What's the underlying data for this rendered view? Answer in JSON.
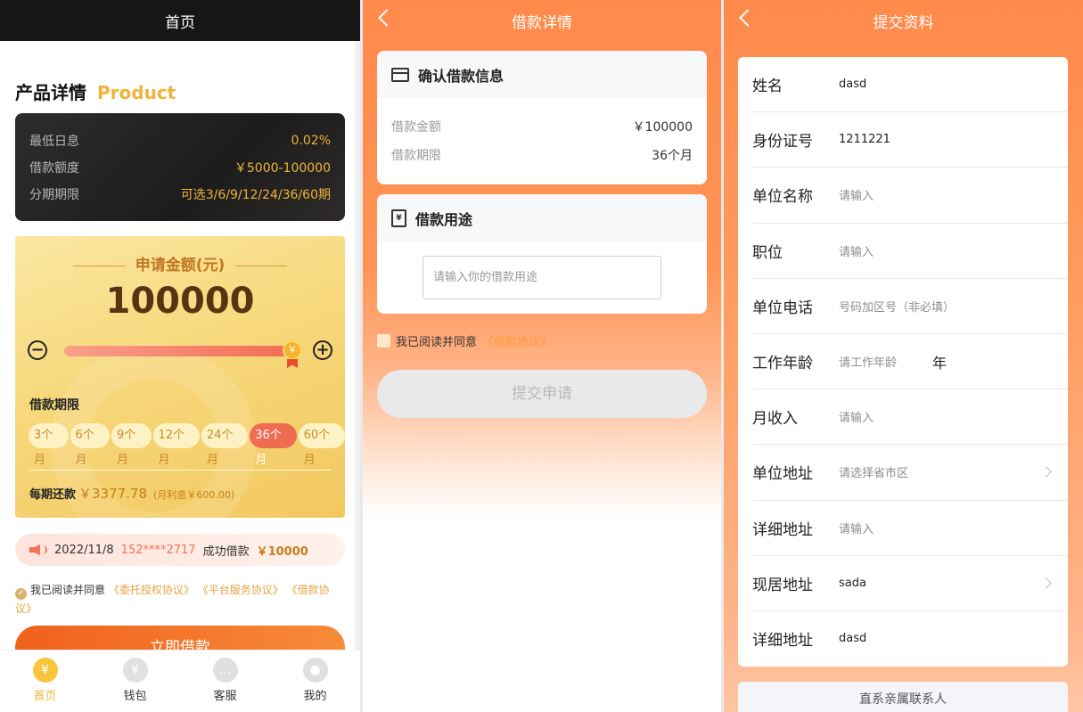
{
  "panel1": {
    "header_title": "首页",
    "heading_zh": "产品详情",
    "heading_en": "Product",
    "rates": [
      {
        "label": "最低日息",
        "value": "0.02%"
      },
      {
        "label": "借款额度",
        "value": "￥5000-100000"
      },
      {
        "label": "分期期限",
        "value": "可选3/6/9/12/24/36/60期"
      }
    ],
    "apply_title": "申请金额(元)",
    "amount": "100000",
    "minus": "−",
    "plus": "+",
    "knob": "¥",
    "slider_level_percent": 100,
    "term_label": "借款期限",
    "terms": [
      "3个月",
      "6个月",
      "9个月",
      "12个月",
      "24个月",
      "36个月",
      "60个月"
    ],
    "active_term_index": 5,
    "repay_label": "每期还款",
    "repay_value": "￥3377.78",
    "repay_interest": "(月利息￥600.00)",
    "notice": {
      "date": "2022/11/8",
      "phone": "152****2717",
      "text": "成功借款",
      "amount": "￥10000"
    },
    "agree_prefix": "我已阅读并同意",
    "agree_links": [
      "《委托授权协议》",
      "《平台服务协议》",
      "《借款协议》"
    ],
    "check_mark": "✓",
    "primary_button": "立即借款",
    "tabs": [
      {
        "label": "首页",
        "icon": "¥",
        "active": true
      },
      {
        "label": "钱包",
        "icon": "¥",
        "active": false
      },
      {
        "label": "客服",
        "icon": "…",
        "active": false
      },
      {
        "label": "我的",
        "icon": "●",
        "active": false
      }
    ]
  },
  "panel2": {
    "header_title": "借款详情",
    "confirm_title": "确认借款信息",
    "loan_amount_label": "借款金额",
    "loan_amount_value": "￥100000",
    "loan_term_label": "借款期限",
    "loan_term_value": "36个月",
    "purpose_title": "借款用途",
    "purpose_icon_glyph": "¥",
    "purpose_placeholder": "请输入你的借款用途",
    "agree_text": "我已阅读并同意",
    "agree_link": "《借款协议》",
    "submit_label": "提交申请"
  },
  "panel3": {
    "header_title": "提交资料",
    "fields": [
      {
        "label": "姓名",
        "value": "dasd",
        "placeholder": "",
        "unit": "",
        "chevron": false
      },
      {
        "label": "身份证号",
        "value": "1211221",
        "placeholder": "",
        "unit": "",
        "chevron": false
      },
      {
        "label": "单位名称",
        "value": "",
        "placeholder": "请输入",
        "unit": "",
        "chevron": false
      },
      {
        "label": "职位",
        "value": "",
        "placeholder": "请输入",
        "unit": "",
        "chevron": false
      },
      {
        "label": "单位电话",
        "value": "",
        "placeholder": "号码加区号（非必填）",
        "unit": "",
        "chevron": false
      },
      {
        "label": "工作年龄",
        "value": "",
        "placeholder": "请工作年龄",
        "unit": "年",
        "chevron": false
      },
      {
        "label": "月收入",
        "value": "",
        "placeholder": "请输入",
        "unit": "",
        "chevron": false
      },
      {
        "label": "单位地址",
        "value": "",
        "placeholder": "请选择省市区",
        "unit": "",
        "chevron": true
      },
      {
        "label": "详细地址",
        "value": "",
        "placeholder": "请输入",
        "unit": "",
        "chevron": false
      },
      {
        "label": "现居地址",
        "value": "sada",
        "placeholder": "",
        "unit": "",
        "chevron": true
      },
      {
        "label": "详细地址",
        "value": "dasd",
        "placeholder": "",
        "unit": "",
        "chevron": false
      }
    ],
    "contact_section_title": "直系亲属联系人"
  }
}
